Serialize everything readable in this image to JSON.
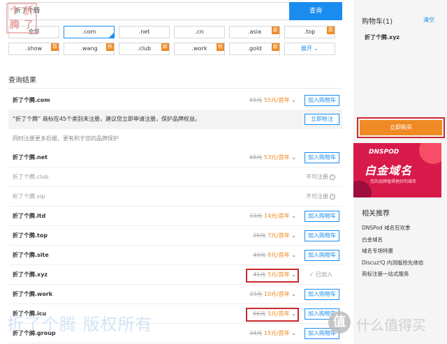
{
  "search": {
    "value": "折了个腾",
    "button": "查询"
  },
  "seal_chars": [
    "个",
    "折",
    "腾",
    "了"
  ],
  "suffixes": [
    {
      "label": "全部",
      "tag": ""
    },
    {
      "label": ".com",
      "tag": ""
    },
    {
      "label": ".net",
      "tag": ""
    },
    {
      "label": ".cn",
      "tag": ""
    },
    {
      "label": ".asia",
      "tag": "新"
    },
    {
      "label": ".top",
      "tag": "荐"
    },
    {
      "label": ".show",
      "tag": "荐"
    },
    {
      "label": ".wang",
      "tag": "热"
    },
    {
      "label": ".club",
      "tag": "新"
    },
    {
      "label": ".work",
      "tag": "热"
    },
    {
      "label": ".gold",
      "tag": "新"
    },
    {
      "label": "展开",
      "tag": ""
    }
  ],
  "results_title": "查询结果",
  "first_result": {
    "name": "折了个腾.com",
    "old": "65元",
    "new": "55元/首年",
    "button": "加入购物车"
  },
  "trademark": {
    "text": "“折了个腾” 商标在45个类别未注册，建议您立即申请注册，保护品牌权益。",
    "button": "立即抢注"
  },
  "hint": "同时注册更多后缀，更有利于您的品牌保护",
  "results": [
    {
      "name": "折了个腾.net",
      "old": "68元",
      "new": "53元/首年",
      "action": "加入购物车",
      "type": "cart"
    },
    {
      "name": "折了个腾.club",
      "action": "不可注册",
      "type": "unavailable"
    },
    {
      "name": "折了个腾.vip",
      "action": "不可注册",
      "type": "unavailable"
    },
    {
      "name": "折了个腾.ltd",
      "old": "33元",
      "new": "14元/首年",
      "action": "加入购物车",
      "type": "cart"
    },
    {
      "name": "折了个腾.top",
      "old": "25元",
      "new": "7元/首年",
      "action": "加入购物车",
      "type": "cart"
    },
    {
      "name": "折了个腾.site",
      "old": "49元",
      "new": "8元/首年",
      "action": "加入购物车",
      "type": "cart"
    },
    {
      "name": "折了个腾.xyz",
      "old": "41元",
      "new": "5元/首年",
      "action": "已加入",
      "type": "added"
    },
    {
      "name": "折了个腾.work",
      "old": "33元",
      "new": "10元/首年",
      "action": "加入购物车",
      "type": "cart"
    },
    {
      "name": "折了个腾.icu",
      "old": "66元",
      "new": "5元/首年",
      "action": "加入购物车",
      "type": "cart"
    },
    {
      "name": "折了个腾.group",
      "old": "34元",
      "new": "15元/首年",
      "action": "加入购物车",
      "type": "cart"
    }
  ],
  "cart": {
    "title": "购物车(1)",
    "clear": "清空",
    "item": "折了个腾.xyz",
    "buy": "立即购买"
  },
  "banner": {
    "line1": "DNSPOD",
    "line2": "白金域名",
    "line3": "您的品牌值得更好的域名"
  },
  "recommend": {
    "title": "相关推荐",
    "items": [
      "DNSPod 域名狂欢季",
      "白金域名",
      "域名专场特惠",
      "Discuz!Q 内测版抢先体验",
      "商标注册一站式服务"
    ]
  },
  "watermark": "折了个腾 版权所有",
  "zdm_logo": "值",
  "zdm_text": "什么值得买",
  "colors": {
    "primary": "#1a8cf0",
    "accent": "#f08a24",
    "highlight": "#c9282d"
  }
}
